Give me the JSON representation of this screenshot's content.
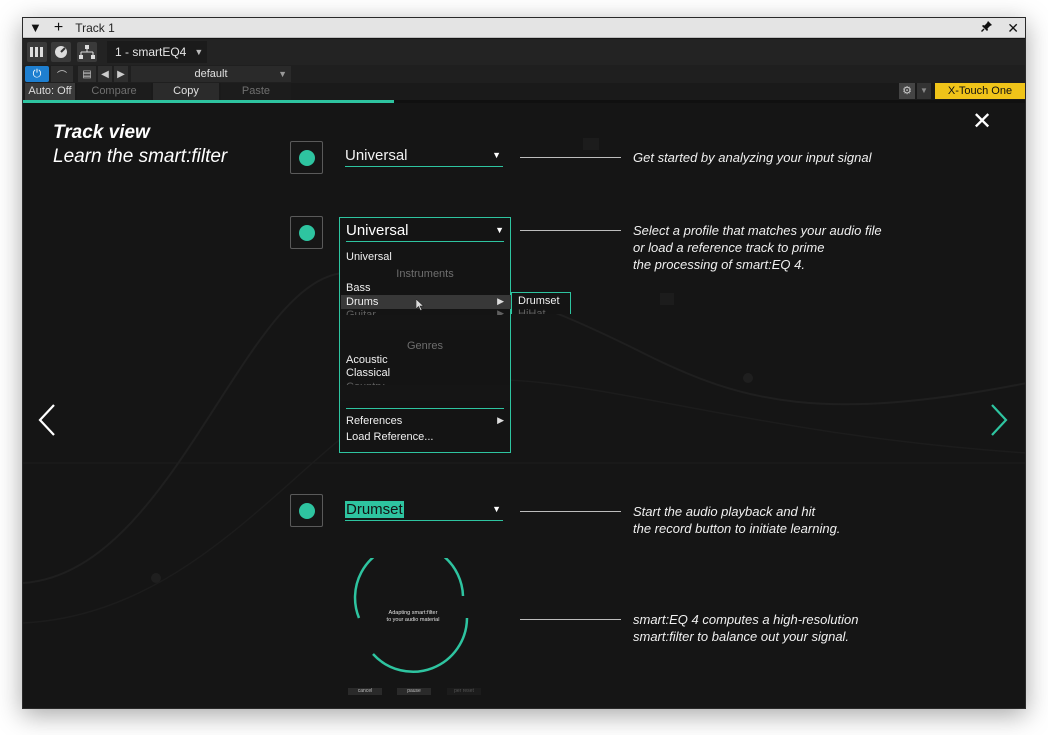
{
  "window": {
    "title": "Track 1",
    "add_symbol": "+",
    "menu_symbol": "▼",
    "pin_symbol": "📌",
    "close_symbol": "✕"
  },
  "plugin": {
    "preset_slot": "1 - smartEQ4",
    "preset_name": "default",
    "auto_label": "Auto: Off",
    "compare_label": "Compare",
    "copy_label": "Copy",
    "paste_label": "Paste",
    "xtouch_label": "X-Touch One",
    "accent_color": "#2ec4a0",
    "progress_fraction": 0.37
  },
  "tutorial": {
    "title": "Track view",
    "subtitle": "Learn the smart:filter",
    "steps": [
      {
        "dropdown": "Universal",
        "caption_lines": [
          "Get started by analyzing your input signal"
        ]
      },
      {
        "dropdown": "Universal",
        "caption_lines": [
          "Select a profile that matches your audio file",
          "or load a reference track to prime",
          "the processing of smart:EQ 4."
        ]
      },
      {
        "dropdown": "Drumset",
        "caption_lines": [
          "Start the audio playback and hit",
          "the record button to initiate learning."
        ]
      },
      {
        "caption_lines": [
          "smart:EQ 4 computes a high-resolution",
          "smart:filter to balance out your signal."
        ]
      }
    ],
    "menu": {
      "universal": "Universal",
      "instruments_header": "Instruments",
      "bass": "Bass",
      "drums": "Drums",
      "guitar": "Guitar",
      "genres_header": "Genres",
      "acoustic": "Acoustic",
      "classical": "Classical",
      "country": "Country",
      "references": "References",
      "load_reference": "Load Reference...",
      "submenu_drumset": "Drumset",
      "submenu_hihat": "HiHat"
    },
    "learning_card": {
      "line1": "Adapting smart:filter",
      "line2": "to your audio material",
      "cancel": "cancel",
      "pause": "pause",
      "no_reset": "per reset"
    }
  }
}
